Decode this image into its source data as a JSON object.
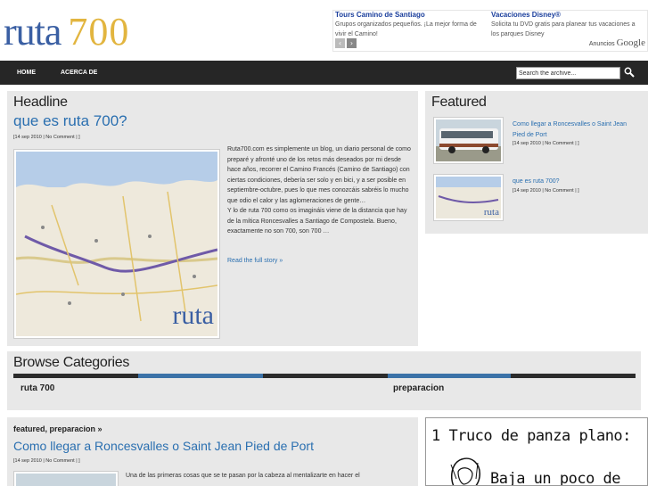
{
  "logo": {
    "word": "ruta",
    "number": "700"
  },
  "ads": {
    "items": [
      {
        "title": "Tours Camino de Santiago",
        "desc": "Grupos organizados pequeños. ¡La mejor forma de vivir el Camino!"
      },
      {
        "title": "Vacaciones Disney®",
        "desc": "Solicita tu DVD gratis para planear tus vacaciones a los parques Disney"
      }
    ],
    "prev_icon": "‹",
    "next_icon": "›",
    "ads_by_label": "Anuncios",
    "ads_by_brand": "Google"
  },
  "nav": {
    "items": [
      "HOME",
      "ACERCA DE"
    ],
    "search_placeholder": "Search the archive..."
  },
  "headline": {
    "section_title": "Headline",
    "post_title": "que es ruta 700?",
    "meta": "[14 sep 2010 | No Comment | ]",
    "map_label": "ruta",
    "excerpt": "Ruta700.com es simplemente un blog, un diario personal de como preparé y afronté uno de los retos más deseados por mi desde hace años, recorrer el Camino Francés (Camino de Santiago) con ciertas condiciones, debería ser solo y en bici, y a ser posible en septiembre-octubre, pues lo que mes conozcáis sabréis lo mucho que odio el calor y las aglomeraciones de gente…\n Y lo de ruta 700 como os imagináis viene de la distancia que hay de la mítica Roncesvalles a Santiago de Compostela. Bueno, exactamente no son 700, son 700 …",
    "read_more": "Read the full story »"
  },
  "featured": {
    "section_title": "Featured",
    "items": [
      {
        "title": "Como llegar a Roncesvalles o Saint Jean Pied de Port",
        "meta": "[14 sep 2010 | No Comment | ]"
      },
      {
        "title": "que es ruta 700?",
        "meta": "[14 sep 2010 | No Comment | ]",
        "thumb_label": "ruta"
      }
    ]
  },
  "categories": {
    "section_title": "Browse Categories",
    "items": [
      "ruta 700",
      "preparacion"
    ],
    "bar_colors": [
      "#2b2b2b",
      "#3b72a8",
      "#2b2b2b",
      "#3b72a8",
      "#2b2b2b"
    ]
  },
  "bottom_post": {
    "categories": "featured, preparacion »",
    "title": "Como llegar a Roncesvalles o Saint Jean Pied de Port",
    "meta": "[14 sep 2010 | No Comment | ]",
    "excerpt": "Una de las primeras cosas que se te pasan por la cabeza al mentalizarte en hacer el"
  },
  "side_ad": {
    "line1": "1 Truco de panza plano:",
    "line2": "Baja un poco de"
  },
  "colors": {
    "link": "#2a6fb0",
    "nav_bg": "#262626",
    "panel_bg": "#e8e8e8",
    "logo_blue": "#3a5fa3",
    "logo_gold": "#e2b53f"
  }
}
